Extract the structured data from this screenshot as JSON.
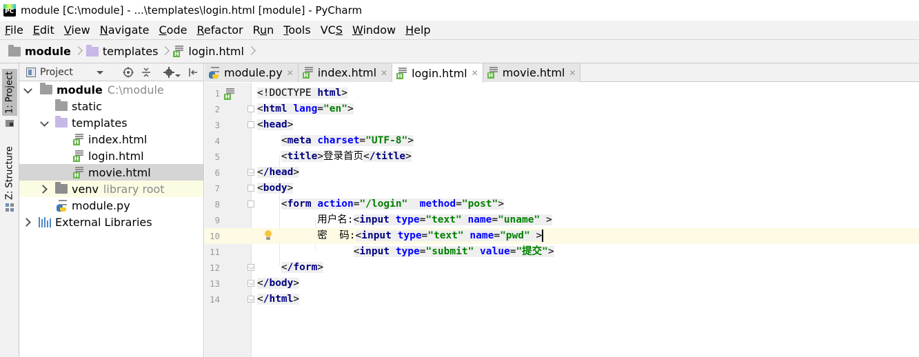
{
  "window": {
    "title": "module [C:\\module] - ...\\templates\\login.html [module] - PyCharm",
    "app_badge": "PC"
  },
  "menu": [
    "File",
    "Edit",
    "View",
    "Navigate",
    "Code",
    "Refactor",
    "Run",
    "Tools",
    "VCS",
    "Window",
    "Help"
  ],
  "menu_mnemonic_index": [
    0,
    0,
    0,
    0,
    0,
    0,
    1,
    0,
    2,
    0,
    0
  ],
  "breadcrumb": {
    "root": "module",
    "folder": "templates",
    "file": "login.html"
  },
  "tool_strip": {
    "project_tab": "1: Project",
    "structure_tab": "Z: Structure"
  },
  "project_panel": {
    "title": "Project",
    "tree": [
      {
        "name": "module",
        "detail": "C:\\module",
        "type": "folder-root",
        "expanded": true
      },
      {
        "name": "static",
        "type": "folder"
      },
      {
        "name": "templates",
        "type": "folder-purple",
        "expanded": true
      },
      {
        "name": "index.html",
        "type": "html"
      },
      {
        "name": "login.html",
        "type": "html"
      },
      {
        "name": "movie.html",
        "type": "html",
        "selected": true
      },
      {
        "name": "venv",
        "detail": "library root",
        "type": "folder-venv",
        "collapsed": true
      },
      {
        "name": "module.py",
        "type": "python"
      },
      {
        "name": "External Libraries",
        "type": "libraries",
        "collapsed": true
      }
    ]
  },
  "tabs": [
    {
      "label": "module.py",
      "type": "python",
      "active": false
    },
    {
      "label": "index.html",
      "type": "html",
      "active": false
    },
    {
      "label": "login.html",
      "type": "html",
      "active": true
    },
    {
      "label": "movie.html",
      "type": "html",
      "active": false
    }
  ],
  "editor": {
    "current_line": 10,
    "lines": [
      {
        "n": "1",
        "text": "<!DOCTYPE html>"
      },
      {
        "n": "2",
        "text": "<html lang=\"en\">"
      },
      {
        "n": "3",
        "text": "<head>"
      },
      {
        "n": "4",
        "text": "    <meta charset=\"UTF-8\">"
      },
      {
        "n": "5",
        "text": "    <title>登录首页</title>"
      },
      {
        "n": "6",
        "text": "</head>"
      },
      {
        "n": "7",
        "text": "<body>"
      },
      {
        "n": "8",
        "text": "    <form action=\"/login\"  method=\"post\">"
      },
      {
        "n": "9",
        "text": "          用户名:<input type=\"text\" name=\"uname\" >"
      },
      {
        "n": "10",
        "text": "          密  码:<input type=\"text\" name=\"pwd\" >"
      },
      {
        "n": "11",
        "text": "                <input type=\"submit\" value=\"提交\">"
      },
      {
        "n": "12",
        "text": "    </form>"
      },
      {
        "n": "13",
        "text": "</body>"
      },
      {
        "n": "14",
        "text": "</html>"
      }
    ]
  }
}
